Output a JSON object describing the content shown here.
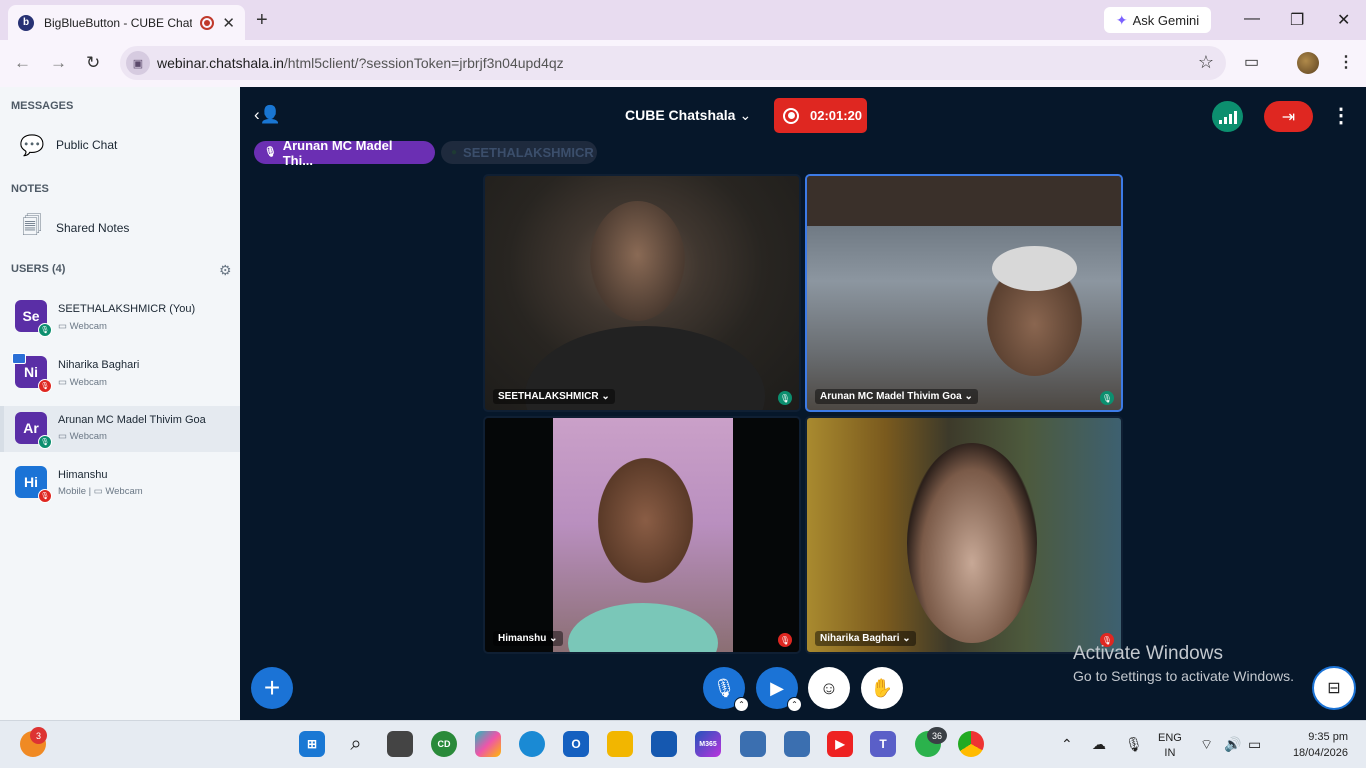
{
  "browser": {
    "tab_title": "BigBlueButton - CUBE Chatshala",
    "favicon_letter": "b",
    "new_tab": "+",
    "ask_gemini": "Ask Gemini",
    "url_host": "webinar.chatshala.in",
    "url_path": "/html5client/?sessionToken=jrbrjf3n04upd4qz"
  },
  "sidebar": {
    "messages_heading": "MESSAGES",
    "public_chat": "Public Chat",
    "notes_heading": "NOTES",
    "shared_notes": "Shared Notes",
    "users_heading": "USERS (4)",
    "users": [
      {
        "initials": "Se",
        "name": "SEETHALAKSHMICR (You)",
        "sub": "▭ Webcam",
        "color": "#5a2ea6",
        "mic": "on"
      },
      {
        "initials": "Ni",
        "name": "Niharika Baghari",
        "sub": "▭ Webcam",
        "color": "#5a2ea6",
        "mic": "off"
      },
      {
        "initials": "Ar",
        "name": "Arunan MC Madel Thivim Goa",
        "sub": "▭ Webcam",
        "color": "#5a2ea6",
        "mic": "on"
      },
      {
        "initials": "Hi",
        "name": "Himanshu",
        "sub": "Mobile | ▭ Webcam",
        "color": "#1b73d6",
        "mic": "off"
      }
    ]
  },
  "meeting": {
    "conference_name": "CUBE Chatshala",
    "recording_time": "02:01:20",
    "talkers": [
      "Arunan MC Madel Thi...",
      "SEETHALAKSHMICR"
    ],
    "videos": [
      {
        "name": "SEETHALAKSHMICR",
        "mic": "on"
      },
      {
        "name": "Arunan MC Madel Thivim Goa",
        "mic": "on"
      },
      {
        "name": "Himanshu",
        "mic": "off"
      },
      {
        "name": "Niharika Baghari",
        "mic": "off"
      }
    ]
  },
  "watermark": {
    "line1": "Activate Windows",
    "line2": "Go to Settings to activate Windows."
  },
  "taskbar": {
    "weather_badge": "3",
    "whatsapp_badge": "36",
    "m365_label": "M365",
    "lang_line1": "ENG",
    "lang_line2": "IN",
    "time": "9:35 pm",
    "date": "18/04/2026"
  },
  "colors": {
    "accent": "#1b73d6",
    "danger": "#df2721",
    "success": "#0c8f6f",
    "talker": "#6b2fb3",
    "main_bg": "#06172a"
  }
}
